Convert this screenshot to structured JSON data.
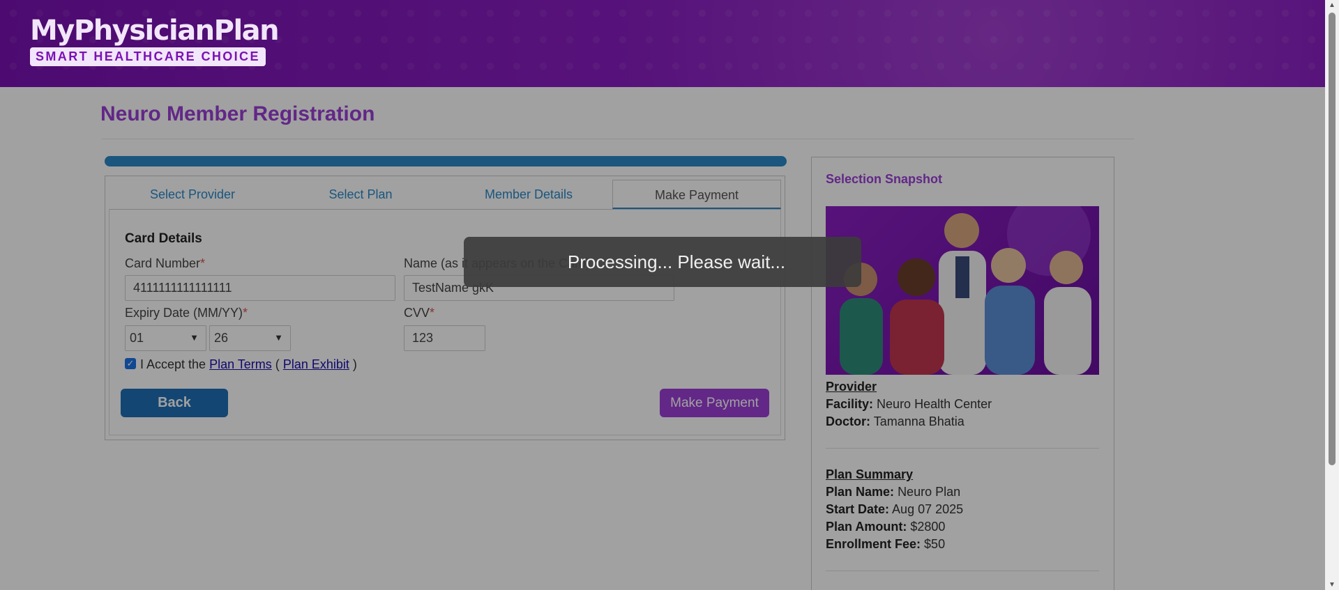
{
  "header": {
    "logo_main": "MyPhysicianPlan",
    "logo_sub": "SMART HEALTHCARE CHOICE",
    "bg_color": "#7a12b3"
  },
  "page": {
    "title": "Neuro Member Registration"
  },
  "progress": {
    "percent": 100,
    "color": "#2a88c8"
  },
  "tabs": [
    {
      "label": "Select Provider"
    },
    {
      "label": "Select Plan"
    },
    {
      "label": "Member Details"
    },
    {
      "label": "Make Payment",
      "active": true
    }
  ],
  "form": {
    "section_title": "Card Details",
    "card_number_label": "Card Number",
    "card_number_value": "4111111111111111",
    "name_label": "Name (as it appears on the Card)",
    "name_value": "TestName gkK",
    "expiry_label": "Expiry Date (MM/YY)",
    "expiry_month": "01",
    "expiry_year": "26",
    "cvv_label": "CVV",
    "cvv_value": "123",
    "required_mark": "*",
    "accept_prefix": "I Accept the",
    "plan_terms_link": "Plan Terms",
    "open_paren": "(",
    "plan_exhibit_link": "Plan Exhibit",
    "close_paren": ")",
    "back_label": "Back",
    "pay_label": "Make Payment",
    "accepted": true
  },
  "snapshot": {
    "title": "Selection Snapshot",
    "provider_heading": "Provider",
    "facility_label": "Facility:",
    "facility_value": "Neuro Health Center",
    "doctor_label": "Doctor:",
    "doctor_value": "Tamanna Bhatia",
    "plan_heading": "Plan Summary",
    "plan_name_label": "Plan Name:",
    "plan_name_value": "Neuro Plan",
    "start_date_label": "Start Date:",
    "start_date_value": "Aug 07 2025",
    "plan_amount_label": "Plan Amount:",
    "plan_amount_value": "$2800",
    "enroll_fee_label": "Enrollment Fee:",
    "enroll_fee_value": "$50"
  },
  "overlay": {
    "message": "Processing... Please wait..."
  },
  "colors": {
    "accent_purple": "#9b3fd6",
    "accent_blue": "#2a88c8",
    "button_blue": "#1f6fb5"
  }
}
